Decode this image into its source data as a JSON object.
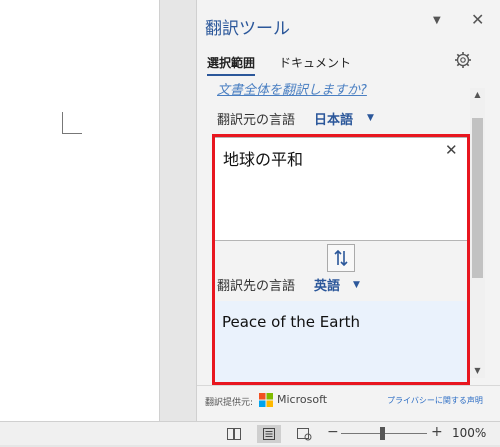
{
  "pane": {
    "title": "翻訳ツール",
    "dropdown_glyph": "▼",
    "close_glyph": "✕"
  },
  "tabs": {
    "selection": "選択範囲",
    "document": "ドキュメント"
  },
  "translate_document_link": "文書全体を翻訳しますか?",
  "source": {
    "label": "翻訳元の言語",
    "language": "日本語",
    "text": "地球の平和",
    "clear_glyph": "✕"
  },
  "target": {
    "label": "翻訳先の言語",
    "language": "英語",
    "text": "Peace of the Earth"
  },
  "footer": {
    "provider_label": "翻訳提供元:",
    "provider_name": "Microsoft",
    "privacy_link": "プライバシーに関する声明"
  },
  "statusbar": {
    "zoom_minus": "−",
    "zoom_plus": "+",
    "zoom_level": "100%",
    "zoom_fraction": 1.0
  },
  "colors": {
    "accent": "#2b579a",
    "highlight": "#e8161f",
    "target_bg": "#eaf2fc"
  },
  "icons": [
    "settings-gear-icon",
    "swap-languages-icon",
    "microsoft-logo",
    "read-mode-icon",
    "print-layout-icon",
    "web-layout-icon"
  ]
}
